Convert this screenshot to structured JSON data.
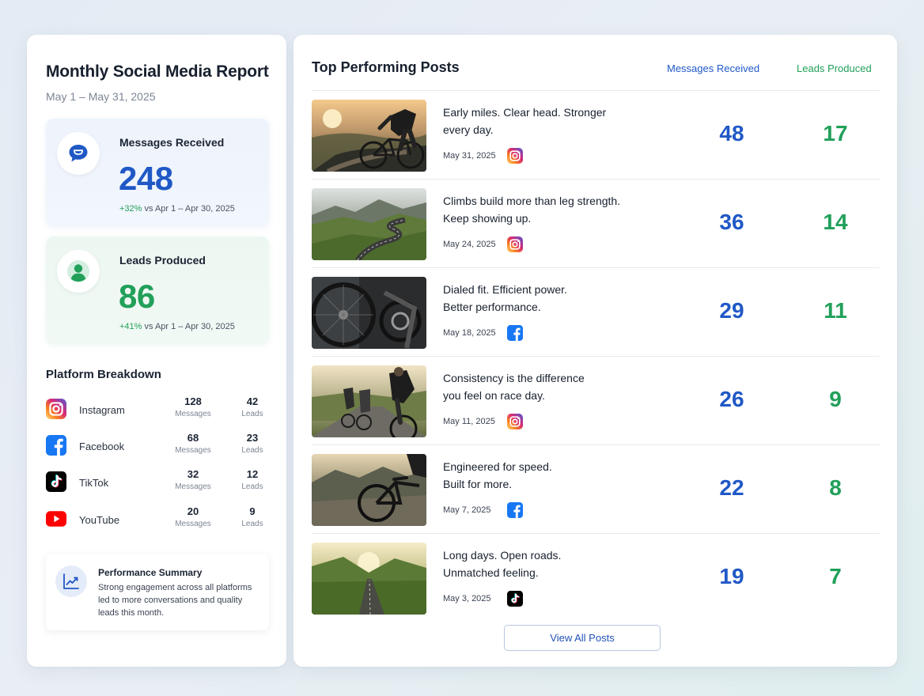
{
  "report": {
    "title": "Monthly Social Media Report",
    "date_range": "May 1 – May 31, 2025"
  },
  "stats": {
    "messages": {
      "label": "Messages Received",
      "value": "248",
      "change_pct": "+32%",
      "change_text": " vs Apr 1 – Apr 30, 2025",
      "icon": "chat-bubble-icon",
      "color": "#2058c6"
    },
    "leads": {
      "label": "Leads Produced",
      "value": "86",
      "change_pct": "+41%",
      "change_text": " vs Apr 1 – Apr 30, 2025",
      "icon": "user-icon",
      "color": "#21a05a"
    }
  },
  "platform_breakdown": {
    "title": "Platform Breakdown",
    "messages_unit": "Messages",
    "leads_unit": "Leads",
    "platforms": [
      {
        "name": "Instagram",
        "icon": "instagram-icon",
        "messages": "128",
        "leads": "42"
      },
      {
        "name": "Facebook",
        "icon": "facebook-icon",
        "messages": "68",
        "leads": "23"
      },
      {
        "name": "TikTok",
        "icon": "tiktok-icon",
        "messages": "32",
        "leads": "12"
      },
      {
        "name": "YouTube",
        "icon": "youtube-icon",
        "messages": "20",
        "leads": "9"
      }
    ]
  },
  "summary": {
    "title": "Performance Summary",
    "text": "Strong engagement across all platforms led to more conversations and quality leads this month.",
    "icon": "trend-chart-icon"
  },
  "top_posts": {
    "title": "Top Performing Posts",
    "col_messages": "Messages Received",
    "col_leads": "Leads Produced",
    "view_all": "View All Posts",
    "posts": [
      {
        "line1": "Early miles. Clear head. Stronger",
        "line2": "every day.",
        "date": "May 31, 2025",
        "platform": "instagram-icon",
        "messages": "48",
        "leads": "17"
      },
      {
        "line1": "Climbs build more than leg strength.",
        "line2": "Keep showing up.",
        "date": "May 24, 2025",
        "platform": "instagram-icon",
        "messages": "36",
        "leads": "14"
      },
      {
        "line1": "Dialed fit. Efficient power.",
        "line2": "Better performance.",
        "date": "May 18, 2025",
        "platform": "facebook-icon",
        "messages": "29",
        "leads": "11"
      },
      {
        "line1": "Consistency is the difference",
        "line2": "you feel on race day.",
        "date": "May 11, 2025",
        "platform": "instagram-icon",
        "messages": "26",
        "leads": "9"
      },
      {
        "line1": "Engineered for speed.",
        "line2": "Built for more.",
        "date": "May 7, 2025",
        "platform": "facebook-icon",
        "messages": "22",
        "leads": "8"
      },
      {
        "line1": "Long days. Open roads.",
        "line2": "Unmatched feeling.",
        "date": "May 3, 2025",
        "platform": "tiktok-icon",
        "messages": "19",
        "leads": "7"
      }
    ]
  },
  "colors": {
    "brand_blue": "#2058c6",
    "brand_green": "#21a05a",
    "instagram": "#dd2a7b",
    "facebook": "#1877f2",
    "tiktok": "#000000",
    "youtube": "#ff0000"
  }
}
